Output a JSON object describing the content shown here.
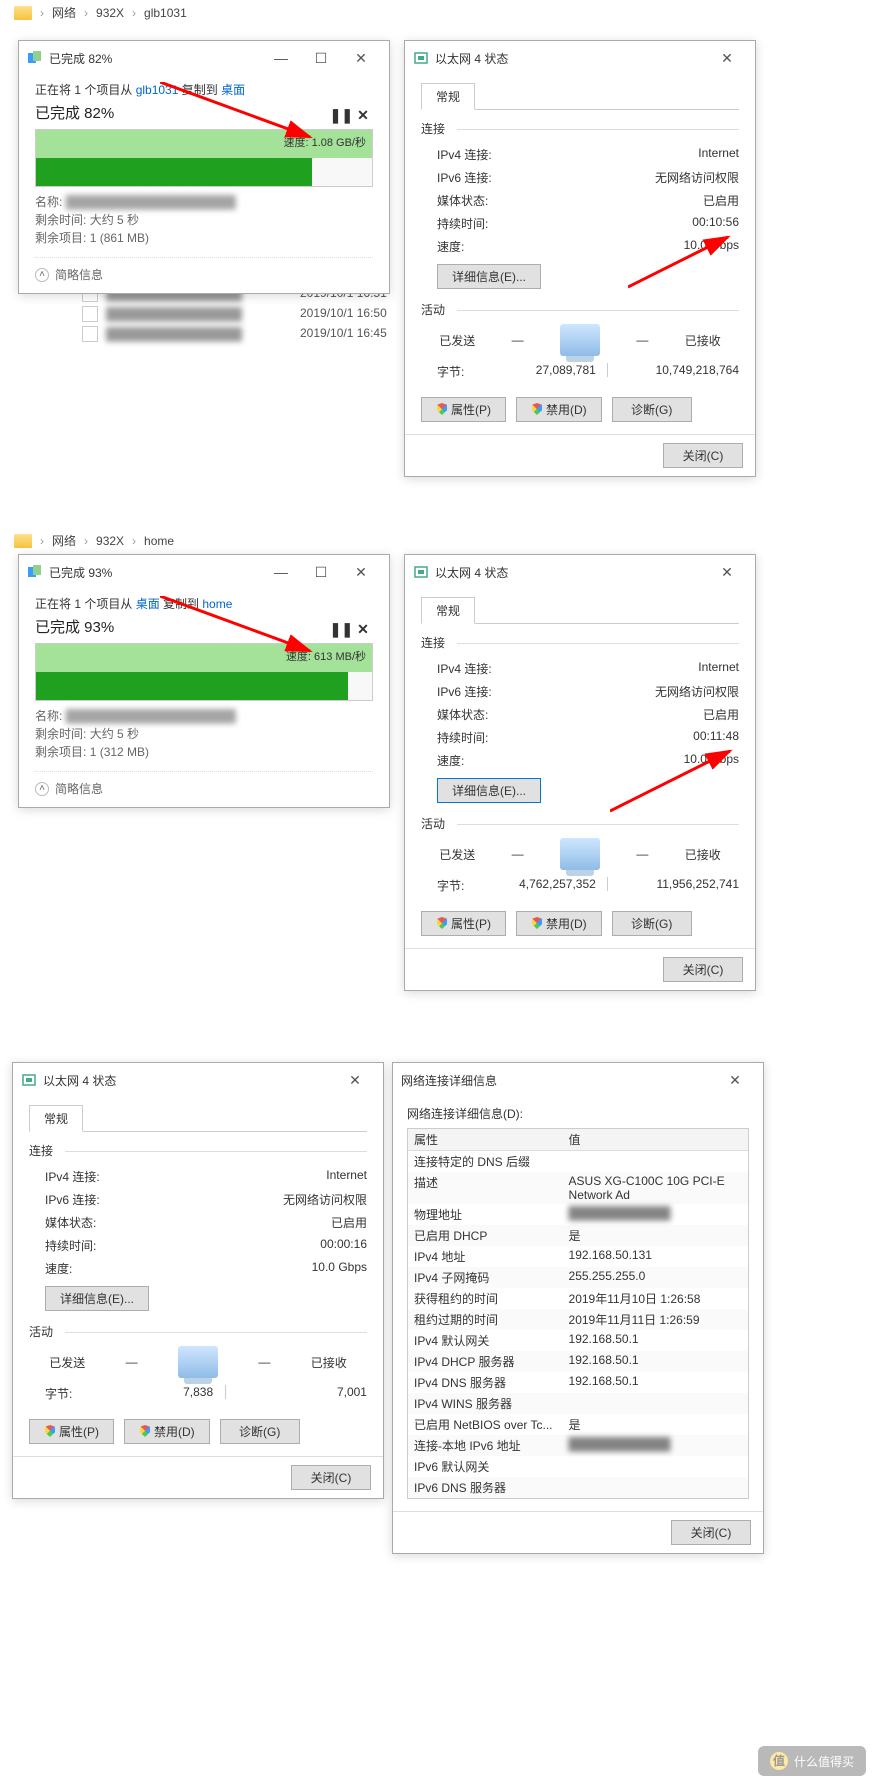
{
  "section1": {
    "crumb": {
      "p1": "网络",
      "p2": "932X",
      "p3": "glb1031"
    },
    "copy": {
      "title": "已完成 82%",
      "sub_prefix": "正在将 1 个项目从 ",
      "src": "glb1031",
      "sub_mid": " 复制到 ",
      "dst": "桌面",
      "done": "已完成 82%",
      "speed_label": "速度:",
      "speed_value": "1.08 GB/秒",
      "name_label": "名称:",
      "remain_label": "剩余时间:",
      "remain_value": "大约 5 秒",
      "items_label": "剩余项目:",
      "items_value": "1 (861 MB)",
      "brief": "简略信息",
      "pause_icon": "pause-icon",
      "cancel_icon": "cancel-icon"
    },
    "explorer_rows": [
      {
        "date": "2019/10/1 16:51"
      },
      {
        "date": "2019/10/1 16:50"
      },
      {
        "date": "2019/10/1 16:45"
      }
    ],
    "eth": {
      "title": "以太网 4 状态",
      "tab": "常规",
      "grp_conn": "连接",
      "ipv4_label": "IPv4 连接:",
      "ipv4_value": "Internet",
      "ipv6_label": "IPv6 连接:",
      "ipv6_value": "无网络访问权限",
      "media_label": "媒体状态:",
      "media_value": "已启用",
      "dur_label": "持续时间:",
      "dur_value": "00:10:56",
      "spd_label": "速度:",
      "spd_value": "10.0 Gbps",
      "details_btn": "详细信息(E)...",
      "grp_act": "活动",
      "sent_label": "已发送",
      "recv_label": "已接收",
      "bytes_label": "字节:",
      "sent_value": "27,089,781",
      "recv_value": "10,749,218,764",
      "props_btn": "属性(P)",
      "disable_btn": "禁用(D)",
      "diag_btn": "诊断(G)",
      "close_btn": "关闭(C)"
    }
  },
  "section2": {
    "crumb": {
      "p1": "网络",
      "p2": "932X",
      "p3": "home"
    },
    "copy": {
      "title": "已完成 93%",
      "sub_prefix": "正在将 1 个项目从 ",
      "src": "桌面",
      "sub_mid": " 复制到 ",
      "dst": "home",
      "done": "已完成 93%",
      "speed_label": "速度:",
      "speed_value": "613 MB/秒",
      "name_label": "名称:",
      "remain_label": "剩余时间:",
      "remain_value": "大约 5 秒",
      "items_label": "剩余项目:",
      "items_value": "1 (312 MB)",
      "brief": "简略信息"
    },
    "eth": {
      "title": "以太网 4 状态",
      "tab": "常规",
      "grp_conn": "连接",
      "ipv4_label": "IPv4 连接:",
      "ipv4_value": "Internet",
      "ipv6_label": "IPv6 连接:",
      "ipv6_value": "无网络访问权限",
      "media_label": "媒体状态:",
      "media_value": "已启用",
      "dur_label": "持续时间:",
      "dur_value": "00:11:48",
      "spd_label": "速度:",
      "spd_value": "10.0 Gbps",
      "details_btn": "详细信息(E)...",
      "grp_act": "活动",
      "sent_label": "已发送",
      "recv_label": "已接收",
      "bytes_label": "字节:",
      "sent_value": "4,762,257,352",
      "recv_value": "11,956,252,741",
      "props_btn": "属性(P)",
      "disable_btn": "禁用(D)",
      "diag_btn": "诊断(G)",
      "close_btn": "关闭(C)"
    }
  },
  "section3": {
    "eth": {
      "title": "以太网 4 状态",
      "tab": "常规",
      "grp_conn": "连接",
      "ipv4_label": "IPv4 连接:",
      "ipv4_value": "Internet",
      "ipv6_label": "IPv6 连接:",
      "ipv6_value": "无网络访问权限",
      "media_label": "媒体状态:",
      "media_value": "已启用",
      "dur_label": "持续时间:",
      "dur_value": "00:00:16",
      "spd_label": "速度:",
      "spd_value": "10.0 Gbps",
      "details_btn": "详细信息(E)...",
      "grp_act": "活动",
      "sent_label": "已发送",
      "recv_label": "已接收",
      "bytes_label": "字节:",
      "sent_value": "7,838",
      "recv_value": "7,001",
      "props_btn": "属性(P)",
      "disable_btn": "禁用(D)",
      "diag_btn": "诊断(G)",
      "close_btn": "关闭(C)"
    },
    "det": {
      "title": "网络连接详细信息",
      "label": "网络连接详细信息(D):",
      "head_prop": "属性",
      "head_val": "值",
      "rows": [
        {
          "p": "连接特定的 DNS 后缀",
          "v": ""
        },
        {
          "p": "描述",
          "v": "ASUS XG-C100C 10G PCI-E Network Ad"
        },
        {
          "p": "物理地址",
          "v": ""
        },
        {
          "p": "已启用 DHCP",
          "v": "是"
        },
        {
          "p": "IPv4 地址",
          "v": "192.168.50.131"
        },
        {
          "p": "IPv4 子网掩码",
          "v": "255.255.255.0"
        },
        {
          "p": "获得租约的时间",
          "v": "2019年11月10日 1:26:58"
        },
        {
          "p": "租约过期的时间",
          "v": "2019年11月11日 1:26:59"
        },
        {
          "p": "IPv4 默认网关",
          "v": "192.168.50.1"
        },
        {
          "p": "IPv4 DHCP 服务器",
          "v": "192.168.50.1"
        },
        {
          "p": "IPv4 DNS 服务器",
          "v": "192.168.50.1"
        },
        {
          "p": "IPv4 WINS 服务器",
          "v": ""
        },
        {
          "p": "已启用 NetBIOS over Tc...",
          "v": "是"
        },
        {
          "p": "连接-本地 IPv6 地址",
          "v": ""
        },
        {
          "p": "IPv6 默认网关",
          "v": ""
        },
        {
          "p": "IPv6 DNS 服务器",
          "v": ""
        }
      ],
      "close_btn": "关闭(C)"
    }
  },
  "watermark": "什么值得买"
}
